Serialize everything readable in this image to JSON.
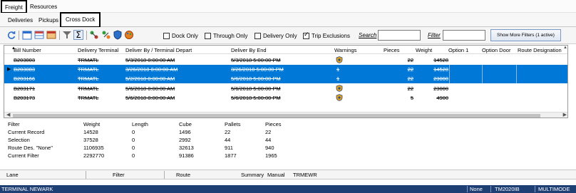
{
  "menu": {
    "freight": "Freight",
    "resources": "Resources"
  },
  "subtabs": {
    "deliveries": "Deliveries",
    "pickups": "Pickups",
    "cross_dock": "Cross Dock"
  },
  "toolbar": {
    "checkboxes": {
      "dock_only": {
        "label": "Dock Only",
        "checked": false
      },
      "through_only": {
        "label": "Through Only",
        "checked": false
      },
      "delivery_only": {
        "label": "Delivery Only",
        "checked": false
      },
      "trip_exclusions": {
        "label": "Trip Exclusions",
        "checked": true
      }
    },
    "search_label": "Search",
    "search_value": "",
    "filter_label": "Filter",
    "filter_value": "",
    "more_filters_label": "Show More Filters (1 active)"
  },
  "grid": {
    "headers": [
      "Bill Number",
      "Delivery Terminal",
      "Deliver By / Terminal Depart",
      "Deliver By End",
      "Warnings",
      "Pieces",
      "Weight",
      "Option 1",
      "Option Door",
      "Route Designation"
    ],
    "rows": [
      {
        "bill": "B203003",
        "terminal": "TRMATL",
        "deliver_by": "5/3/2018 8:00:00 AM",
        "deliver_end": "5/3/2018 5:00:00 PM",
        "warning": true,
        "pieces": "22",
        "weight": "14528",
        "selected": false
      },
      {
        "bill": "B203083",
        "terminal": "TRMATL",
        "deliver_by": "3/26/2018 8:00:00 AM",
        "deliver_end": "3/26/2018 5:00:00 PM",
        "warning": false,
        "pieces": "1",
        "weight": "14528",
        "selected": true
      },
      {
        "bill": "B203166",
        "terminal": "TRMATL",
        "deliver_by": "5/2/2018 8:00:00 AM",
        "deliver_end": "5/6/2018 5:00:00 PM",
        "warning": false,
        "pieces": "1",
        "weight": "23000",
        "selected": true
      },
      {
        "bill": "B203171",
        "terminal": "TRMATL",
        "deliver_by": "5/6/2018 8:00:00 AM",
        "deliver_end": "5/6/2018 5:00:00 PM",
        "warning": true,
        "pieces": "22",
        "weight": "23000",
        "selected": false
      },
      {
        "bill": "B203173",
        "terminal": "TRMATL",
        "deliver_by": "5/6/2018 8:00:00 AM",
        "deliver_end": "5/6/2018 5:00:00 PM",
        "warning": true,
        "pieces": "5",
        "weight": "4900",
        "selected": false
      }
    ]
  },
  "summary": {
    "headers": [
      "Filter",
      "Weight",
      "Length",
      "Cube",
      "Pallets",
      "Pieces"
    ],
    "rows": [
      [
        "Current Record",
        "14528",
        "0",
        "1496",
        "22",
        "22"
      ],
      [
        "Selection",
        "37528",
        "0",
        "2992",
        "44",
        "44"
      ],
      [
        "Route Des. \"None\"",
        "1106935",
        "0",
        "32613",
        "911",
        "940"
      ],
      [
        "Current Filter",
        "2292770",
        "0",
        "91386",
        "1877",
        "1965"
      ]
    ]
  },
  "bottom_bar": {
    "lane": "Lane",
    "filter": "Filter",
    "route": "Route",
    "summary": "Summary",
    "manual": "Manual",
    "manual_value": "TRMEWR"
  },
  "status_bar": {
    "terminal": "TERMINAL NEWARK",
    "none": "None",
    "version": "TM2020IB",
    "mode": "MULTIMODE"
  },
  "colors": {
    "selection": "#0078d7",
    "status_bar": "#1e3f74",
    "warning": "#e8a317"
  }
}
